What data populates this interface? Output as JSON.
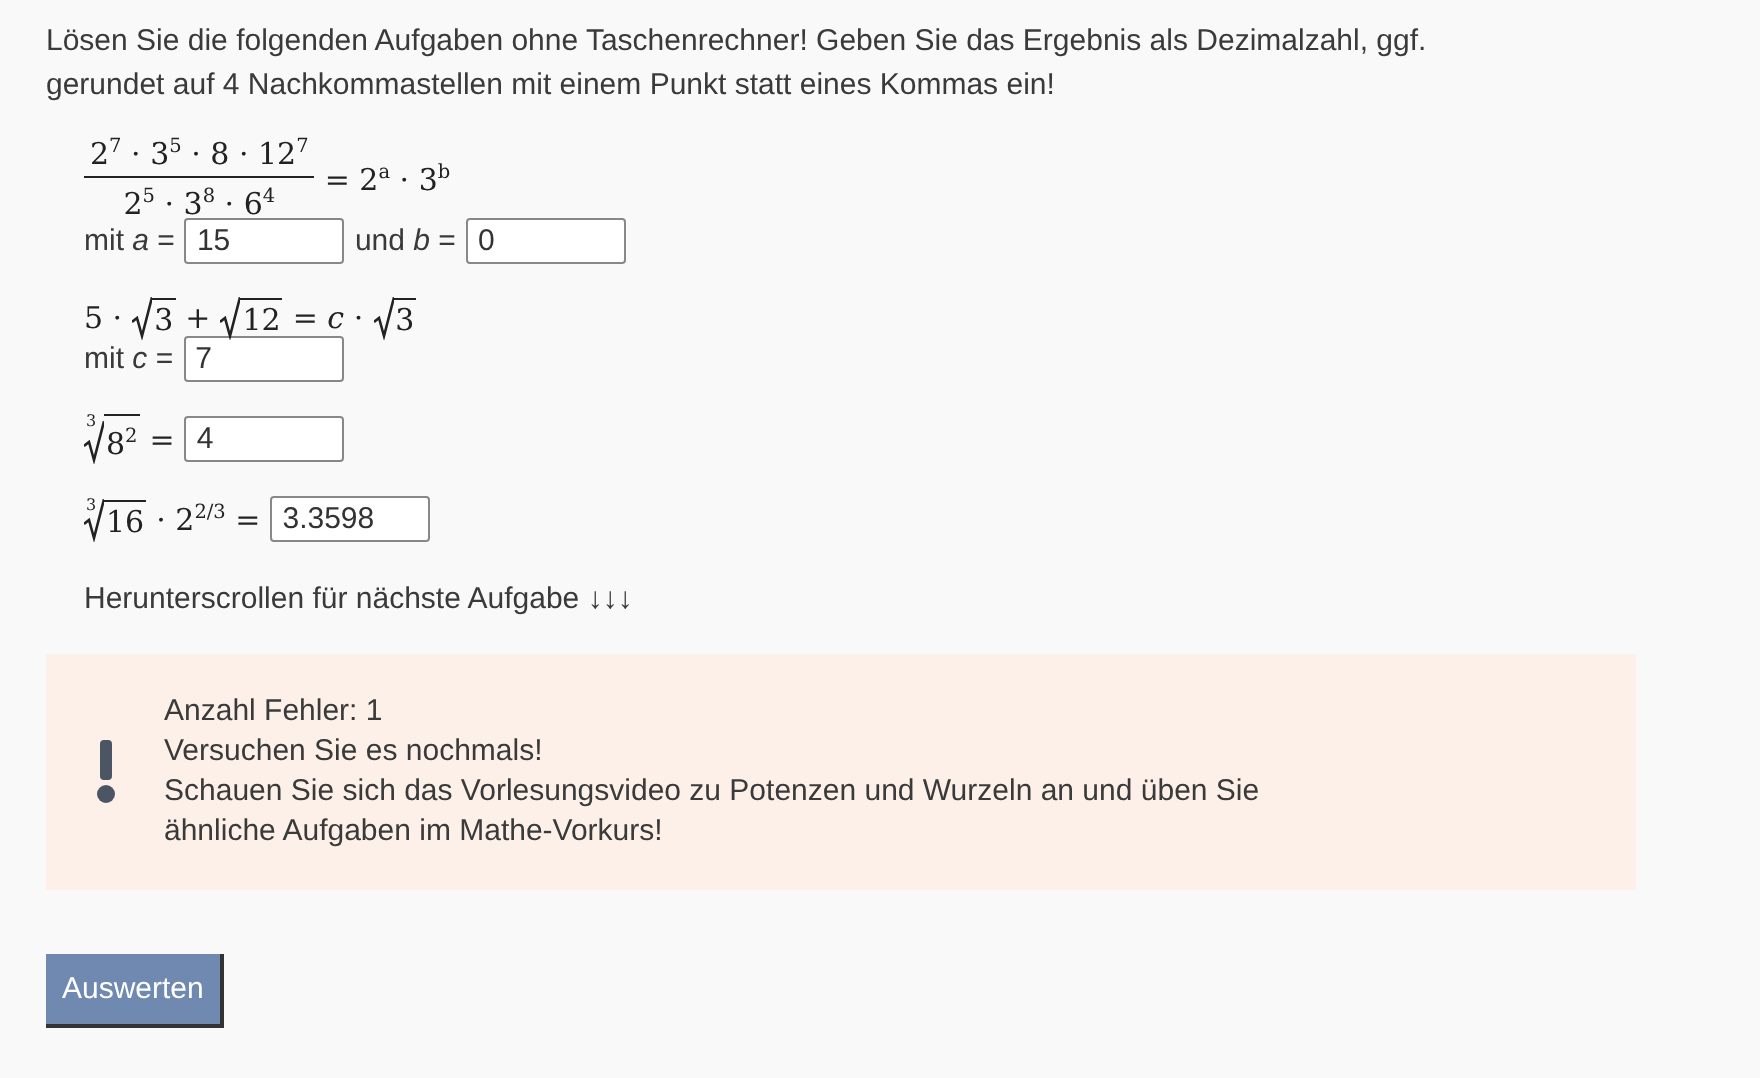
{
  "instructions": "Lösen Sie die folgenden Aufgaben ohne Taschenrechner! Geben Sie das Ergebnis als Dezimalzahl, ggf. gerundet auf 4 Nachkommastellen mit einem Punkt statt eines Kommas ein!",
  "tasks": [
    {
      "formula": [
        {
          "kind": "fraction",
          "numerator": "2$^{7}$ · 3$^{5}$ · 8 · 12$^{7}$",
          "denominator": "2$^{5}$ · 3$^{8}$ · 6$^{4}$"
        },
        {
          "kind": "text",
          "text": "= 2$^{a}$ · 3$^{b}$"
        }
      ],
      "answers": [
        {
          "label": "mit *a* =",
          "value": "15"
        },
        {
          "label": "und *b* =",
          "value": "0"
        }
      ]
    },
    {
      "formula": [
        {
          "kind": "text",
          "text": "5 ·"
        },
        {
          "kind": "root",
          "radicand": "3"
        },
        {
          "kind": "text",
          "text": "+"
        },
        {
          "kind": "root",
          "radicand": "12"
        },
        {
          "kind": "text",
          "text": "= *c* ·"
        },
        {
          "kind": "root",
          "radicand": "3"
        }
      ],
      "answers": [
        {
          "label": "mit *c* =",
          "value": "7"
        }
      ]
    },
    {
      "formula": [
        {
          "kind": "root",
          "index": "3",
          "radicand": "8$^{2}$"
        },
        {
          "kind": "text",
          "text": "="
        }
      ],
      "answers": [
        {
          "value": "4"
        }
      ]
    },
    {
      "formula": [
        {
          "kind": "root",
          "index": "3",
          "radicand": "16"
        },
        {
          "kind": "text",
          "text": "· 2$^{2/3}$ ="
        }
      ],
      "answers": [
        {
          "value": "3.3598"
        }
      ]
    }
  ],
  "scroll_hint": "Herunterscrollen für nächste Aufgabe ↓↓↓",
  "alert": {
    "lines": [
      "Anzahl Fehler: 1",
      "Versuchen Sie es nochmals!",
      "Schauen Sie sich das Vorlesungsvideo zu Potenzen und Wurzeln an und üben Sie ähnliche Aufgaben im Mathe-Vorkurs!"
    ]
  },
  "submit_button": "Auswerten"
}
